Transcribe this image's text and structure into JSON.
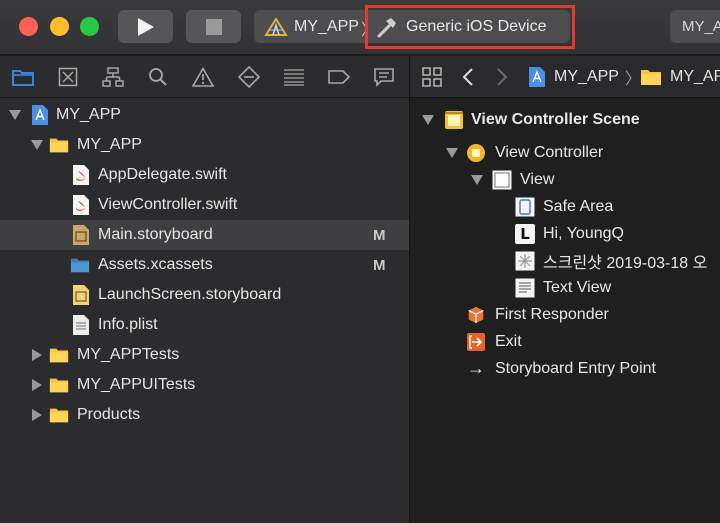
{
  "toolbar": {
    "scheme_app": "MY_APP",
    "scheme_separator": "〉",
    "device": "Generic iOS Device",
    "right_label": "MY_A",
    "colors": {
      "highlight": "#e33a2e",
      "red": "#fe5f57",
      "yellow": "#febc2e",
      "green": "#28c840"
    }
  },
  "navigator": {
    "tabs": [
      "folder-icon",
      "source-control-icon",
      "hierarchy-icon",
      "search-icon",
      "warning-icon",
      "test-icon",
      "debug-icon",
      "breakpoint-icon",
      "report-icon"
    ],
    "items": [
      {
        "label": "MY_APP",
        "icon": "project-icon",
        "badge": ""
      },
      {
        "label": "MY_APP",
        "icon": "folder-icon",
        "badge": ""
      },
      {
        "label": "AppDelegate.swift",
        "icon": "swift-file-icon",
        "badge": ""
      },
      {
        "label": "ViewController.swift",
        "icon": "swift-file-icon",
        "badge": ""
      },
      {
        "label": "Main.storyboard",
        "icon": "storyboard-icon",
        "badge": "M"
      },
      {
        "label": "Assets.xcassets",
        "icon": "asset-catalog-icon",
        "badge": "M"
      },
      {
        "label": "LaunchScreen.storyboard",
        "icon": "storyboard-icon",
        "badge": ""
      },
      {
        "label": "Info.plist",
        "icon": "plist-icon",
        "badge": ""
      },
      {
        "label": "MY_APPTests",
        "icon": "folder-icon",
        "badge": ""
      },
      {
        "label": "MY_APPUITests",
        "icon": "folder-icon",
        "badge": ""
      },
      {
        "label": "Products",
        "icon": "folder-icon",
        "badge": ""
      }
    ]
  },
  "outline": {
    "jump_bar": {
      "project": "MY_APP",
      "separator": "〉",
      "folder": "MY_AP"
    },
    "items": [
      {
        "label": "View Controller Scene",
        "icon": "scene-icon"
      },
      {
        "label": "View Controller",
        "icon": "view-controller-icon"
      },
      {
        "label": "View",
        "icon": "view-icon"
      },
      {
        "label": "Safe Area",
        "icon": "safe-area-icon"
      },
      {
        "label": "Hi, YoungQ",
        "icon": "label-icon",
        "icon_text": "L"
      },
      {
        "label": "스크린샷 2019-03-18 오",
        "icon": "image-view-icon"
      },
      {
        "label": "Text View",
        "icon": "text-view-icon"
      },
      {
        "label": "First Responder",
        "icon": "first-responder-icon"
      },
      {
        "label": "Exit",
        "icon": "exit-icon"
      },
      {
        "label": "Storyboard Entry Point",
        "icon": "arrow-right-icon",
        "icon_text": "→"
      }
    ]
  }
}
